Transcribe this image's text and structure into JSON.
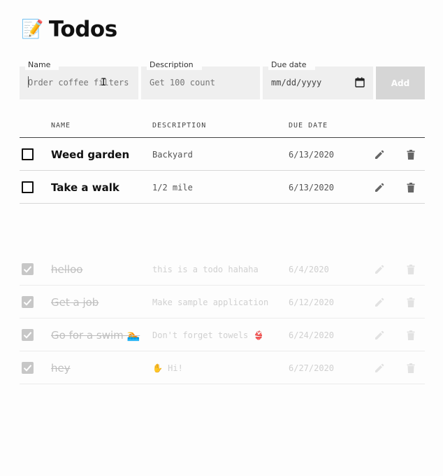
{
  "page": {
    "title": "Todos",
    "title_icon": "📝"
  },
  "form": {
    "name_label": "Name",
    "name_placeholder": "Order coffee filters",
    "description_label": "Description",
    "description_placeholder": "Get 100 count",
    "due_label": "Due date",
    "due_placeholder": "mm/dd/yyyy",
    "add_label": "Add"
  },
  "table": {
    "headers": {
      "name": "NAME",
      "description": "DESCRIPTION",
      "due": "DUE DATE"
    }
  },
  "active_todos": [
    {
      "name": "Weed garden",
      "description": "Backyard",
      "due": "6/13/2020",
      "done": false
    },
    {
      "name": "Take a walk",
      "description": "1/2 mile",
      "due": "6/13/2020",
      "done": false
    }
  ],
  "completed_todos": [
    {
      "name": "helloo",
      "description": "this is a todo hahaha",
      "due": "6/4/2020",
      "done": true
    },
    {
      "name": "Get a job",
      "description": "Make sample application",
      "due": "6/12/2020",
      "done": true
    },
    {
      "name": "Go for a swim 🏊",
      "description": "Don't forget towels 👙",
      "due": "6/24/2020",
      "done": true
    },
    {
      "name": "hey",
      "description": "✋ Hi!",
      "due": "6/27/2020",
      "done": true
    }
  ],
  "icons": {
    "edit": "pencil-icon",
    "delete": "trash-icon",
    "check": "checkmark-icon",
    "calendar": "calendar-icon"
  },
  "colors": {
    "add_button": "#d6d6d6",
    "field_bg": "#efefef",
    "done_text": "#c0c0c0"
  }
}
